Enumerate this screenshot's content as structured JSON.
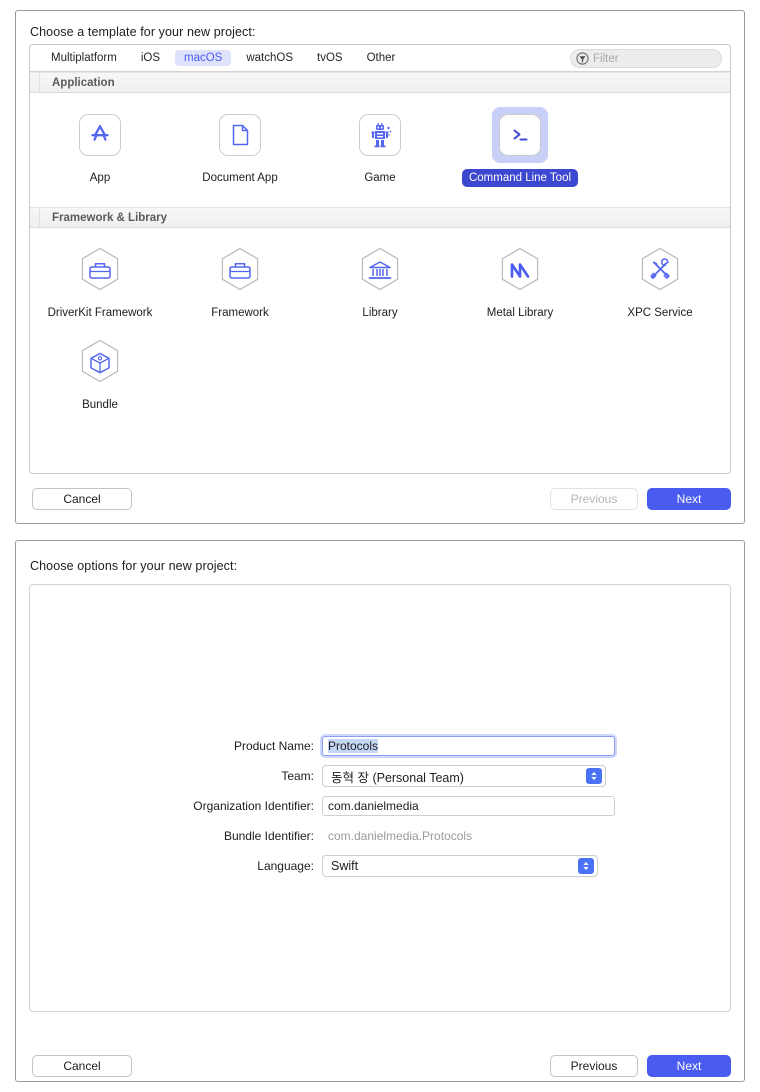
{
  "template_dialog": {
    "title": "Choose a template for your new project:",
    "tabs": [
      {
        "label": "Multiplatform",
        "selected": false
      },
      {
        "label": "iOS",
        "selected": false
      },
      {
        "label": "macOS",
        "selected": true
      },
      {
        "label": "watchOS",
        "selected": false
      },
      {
        "label": "tvOS",
        "selected": false
      },
      {
        "label": "Other",
        "selected": false
      }
    ],
    "filter": {
      "placeholder": "Filter",
      "value": "",
      "icon": "filter-icon"
    },
    "sections": [
      {
        "header": "Application",
        "items": [
          {
            "label": "App",
            "icon": "app-store-icon",
            "style": "tile",
            "selected": false
          },
          {
            "label": "Document App",
            "icon": "document-icon",
            "style": "tile",
            "selected": false
          },
          {
            "label": "Game",
            "icon": "game-robot-icon",
            "style": "tile",
            "selected": false
          },
          {
            "label": "Command Line Tool",
            "icon": "terminal-prompt-icon",
            "style": "tile",
            "selected": true
          },
          {
            "label": "",
            "icon": "",
            "style": "empty",
            "selected": false
          }
        ]
      },
      {
        "header": "Framework & Library",
        "items": [
          {
            "label": "DriverKit Framework",
            "icon": "toolbox-hex-icon",
            "style": "hex",
            "selected": false
          },
          {
            "label": "Framework",
            "icon": "toolbox-hex-icon",
            "style": "hex",
            "selected": false
          },
          {
            "label": "Library",
            "icon": "bank-hex-icon",
            "style": "hex",
            "selected": false
          },
          {
            "label": "Metal Library",
            "icon": "metal-m-hex-icon",
            "style": "hex",
            "selected": false
          },
          {
            "label": "XPC Service",
            "icon": "tools-hex-icon",
            "style": "hex",
            "selected": false
          },
          {
            "label": "Bundle",
            "icon": "cube-hex-icon",
            "style": "hex",
            "selected": false
          }
        ]
      }
    ],
    "buttons": {
      "cancel": "Cancel",
      "previous": "Previous",
      "next": "Next",
      "previous_enabled": false
    }
  },
  "options_dialog": {
    "title": "Choose options for your new project:",
    "fields": [
      {
        "label": "Product Name:",
        "value": "Protocols",
        "type": "text",
        "focused": true,
        "selected_text": true
      },
      {
        "label": "Team:",
        "value": "동혁 장 (Personal Team)",
        "type": "popup"
      },
      {
        "label": "Organization Identifier:",
        "value": "com.danielmedia",
        "type": "text",
        "focused": false
      },
      {
        "label": "Bundle Identifier:",
        "value": "com.danielmedia.Protocols",
        "type": "static"
      },
      {
        "label": "Language:",
        "value": "Swift",
        "type": "popup"
      }
    ],
    "buttons": {
      "cancel": "Cancel",
      "previous": "Previous",
      "next": "Next",
      "previous_enabled": true
    }
  },
  "colors": {
    "accent_blue": "#4a5cf0",
    "selected_label_blue": "#3d47cf",
    "selection_halo": "#c9d0f7",
    "tab_pill": "#dfe2fb",
    "glyph_blue": "#5566ee",
    "hex_outline": "#b9b9b9"
  }
}
